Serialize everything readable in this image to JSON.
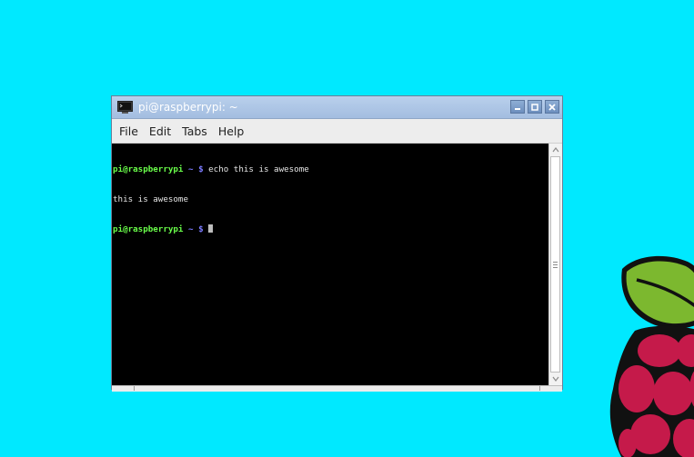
{
  "window": {
    "title": "pi@raspberrypi: ~"
  },
  "menu": {
    "items": [
      "File",
      "Edit",
      "Tabs",
      "Help"
    ]
  },
  "terminal": {
    "lines": [
      {
        "user": "pi@raspberrypi",
        "path": " ~ ",
        "dollar": "$ ",
        "command": "echo this is awesome"
      },
      {
        "output": "this is awesome"
      },
      {
        "user": "pi@raspberrypi",
        "path": " ~ ",
        "dollar": "$ ",
        "command": ""
      }
    ]
  },
  "colors": {
    "desktop": "#00e9ff",
    "prompt_user": "#6aff4a",
    "prompt_path": "#7b7bff",
    "terminal_bg": "#000000"
  },
  "icons": {
    "title": "terminal-icon",
    "minimize": "minimize-icon",
    "maximize": "maximize-icon",
    "close": "close-icon",
    "logo": "raspberry-pi-logo"
  }
}
